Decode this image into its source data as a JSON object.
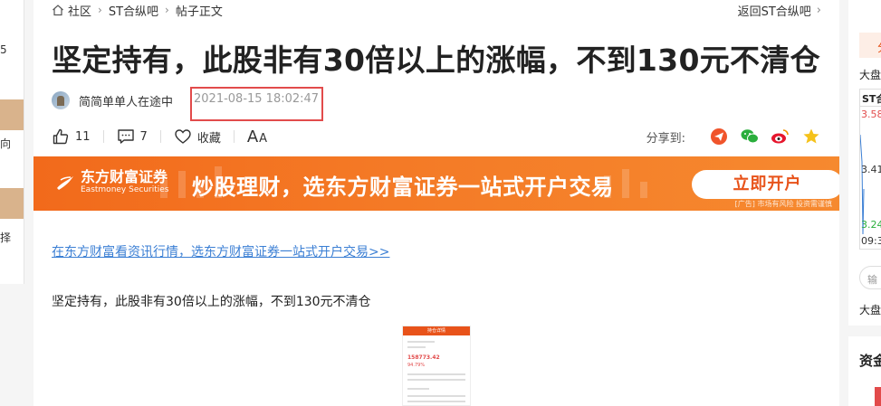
{
  "breadcrumb": {
    "home": "社区",
    "forum": "ST合纵吧",
    "current": "帖子正文",
    "back": "返回ST合纵吧"
  },
  "post": {
    "title": "坚定持有，此股非有30倍以上的涨幅，不到130元不清仓",
    "author": "简简单单人在途中",
    "time": "2021-08-15 18:02:47",
    "likes": "11",
    "comments": "7",
    "favorite_label": "收藏",
    "font_big": "A",
    "font_small": "A",
    "share_label": "分享到:",
    "body": "坚定持有，此股非有30倍以上的涨幅，不到130元不清仓"
  },
  "banner": {
    "logo_cn": "东方财富证券",
    "logo_en": "Eastmoney Securities",
    "slogan": "炒股理财，选东方财富证券一站式开户交易",
    "button": "立即开户",
    "disclaimer": "[广告] 市场有风险 投资需谨慎"
  },
  "ad_link": "在东方财富看资讯行情，选东方财富证券一站式开户交易>>",
  "phone_shot": {
    "header": "持仓详情",
    "value": "158773.42",
    "change": "94.79%"
  },
  "left_panel": {
    "t1": "5",
    "t2": "向",
    "t3": "择"
  },
  "right_panel": {
    "tab": "分",
    "label_top": "大盘",
    "chart_name": "ST合",
    "v1": "3.58",
    "v2": "3.41",
    "v3": "3.24",
    "v4": "09:3",
    "input_placeholder": "输",
    "label_bottom": "大盘",
    "section_title": "资金"
  },
  "colors": {
    "accent": "#e8531a",
    "link": "#3b7fd4",
    "highlight_box": "#e24b4b"
  }
}
